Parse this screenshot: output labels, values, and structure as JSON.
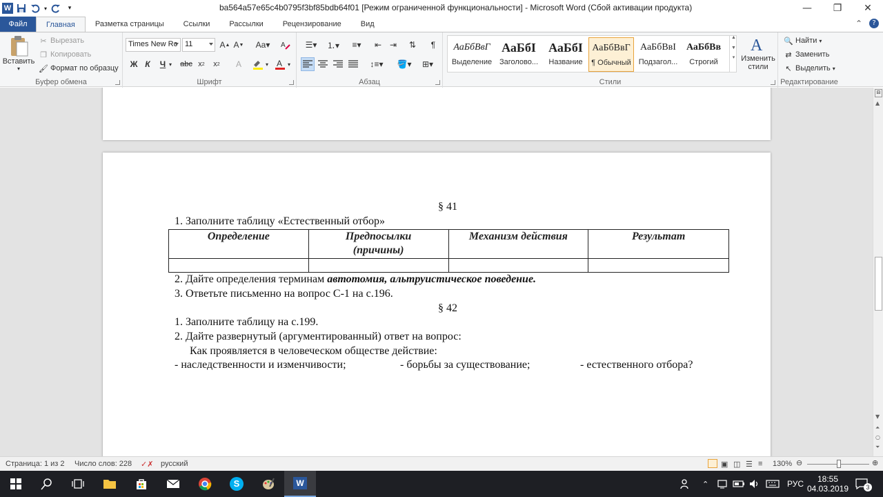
{
  "window": {
    "title": "ba564a57e65c4b0795f3bf85bdb64f01 [Режим ограниченной функциональности]  -  Microsoft Word (Сбой активации продукта)"
  },
  "tabs": [
    "Файл",
    "Главная",
    "Разметка страницы",
    "Ссылки",
    "Рассылки",
    "Рецензирование",
    "Вид"
  ],
  "clipboard": {
    "paste": "Вставить",
    "cut": "Вырезать",
    "copy": "Копировать",
    "format_painter": "Формат по образцу",
    "label": "Буфер обмена"
  },
  "font": {
    "name": "Times New Rc",
    "size": "11",
    "label": "Шрифт"
  },
  "paragraph": {
    "label": "Абзац"
  },
  "styles": {
    "label": "Стили",
    "items": [
      {
        "sample": "АаБбВвГ",
        "name": "Выделение"
      },
      {
        "sample": "АаБбІ",
        "name": "Заголово..."
      },
      {
        "sample": "АаБбІ",
        "name": "Название"
      },
      {
        "sample": "АаБбВвГ",
        "name": "¶ Обычный"
      },
      {
        "sample": "АаБбВвІ",
        "name": "Подзагол..."
      },
      {
        "sample": "АаБбВв",
        "name": "Строгий"
      }
    ],
    "change": "Изменить стили"
  },
  "editing": {
    "label": "Редактирование",
    "find": "Найти",
    "replace": "Заменить",
    "select": "Выделить"
  },
  "document": {
    "section41": "§ 41",
    "task1": "1. Заполните таблицу «Естественный отбор»",
    "table_headers": [
      "Определение",
      "Предпосылки (причины)",
      "Механизм действия",
      "Результат"
    ],
    "task2_prefix": "2. Дайте определения терминам ",
    "task2_terms": "автотомия, альтруистическое поведение.",
    "task3": "3. Ответьте письменно на вопрос С-1 на с.196.",
    "section42": "§ 42",
    "task42_1": "1. Заполните таблицу на с.199.",
    "task42_2": "2. Дайте развернутый (аргументированный) ответ на вопрос:",
    "question": "Как проявляется в человеческом обществе действие:",
    "item_a": "- наследственности  и изменчивости;",
    "item_b": "- борьбы за существование;",
    "item_c": "- естественного  отбора?"
  },
  "status": {
    "page": "Страница: 1 из 2",
    "words": "Число слов: 228",
    "lang": "русский",
    "zoom": "130%"
  },
  "taskbar": {
    "lang": "РУС",
    "time": "18:55",
    "date": "04.03.2019",
    "notif": "3"
  }
}
